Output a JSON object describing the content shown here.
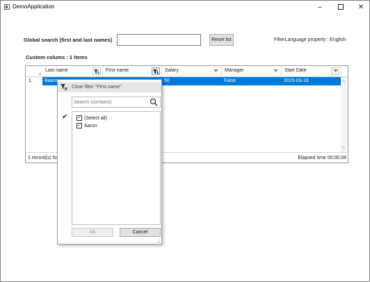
{
  "window": {
    "title": "DemoApplication",
    "minimize": "–",
    "close": "✕"
  },
  "search": {
    "label": "Global search (first and last names)",
    "value": "",
    "reset_label": "Reset list"
  },
  "filter_language": "FilterLanguage property : English",
  "custom_columns": "Custom colums :  1 items",
  "grid": {
    "columns": [
      {
        "label": "Last name"
      },
      {
        "label": "First name"
      },
      {
        "label": "Salary"
      },
      {
        "label": "Manager"
      },
      {
        "label": "Start Date"
      }
    ],
    "rows": [
      {
        "num": "1",
        "last_name": "Baace",
        "salary": "50",
        "manager": "False",
        "start_date": "2015-03-16"
      }
    ],
    "records_text": "1 record(s) fo",
    "elapsed_text": "Elapsed time 00:00.04"
  },
  "filter_popup": {
    "clear_text": "Clear filter \"First name\"",
    "search_placeholder": "Search (contains)",
    "items": [
      {
        "label": "(Select all)",
        "checked": true
      },
      {
        "label": "Aaron",
        "checked": true
      }
    ],
    "ok_label": "Ok",
    "cancel_label": "Cancel"
  },
  "colors": {
    "selection": "#0078d7",
    "border": "#9b9b9b"
  },
  "icons": {
    "filter": "filter-icon",
    "clear_filter": "clear-filter-icon",
    "search": "search-icon"
  }
}
